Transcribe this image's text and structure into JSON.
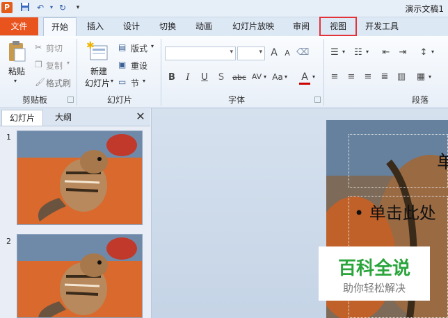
{
  "title_bar": {
    "app_logo": "P",
    "document_title": "演示文稿1"
  },
  "tabs": [
    {
      "label": "文件"
    },
    {
      "label": "开始"
    },
    {
      "label": "插入"
    },
    {
      "label": "设计"
    },
    {
      "label": "切换"
    },
    {
      "label": "动画"
    },
    {
      "label": "幻灯片放映"
    },
    {
      "label": "审阅"
    },
    {
      "label": "视图"
    },
    {
      "label": "开发工具"
    }
  ],
  "ribbon": {
    "clipboard": {
      "paste": "粘贴",
      "cut": "剪切",
      "copy": "复制",
      "format_painter": "格式刷",
      "group_label": "剪贴板"
    },
    "slides": {
      "new_slide_line1": "新建",
      "new_slide_line2": "幻灯片",
      "layout": "版式",
      "reset": "重设",
      "section": "节",
      "group_label": "幻灯片"
    },
    "font": {
      "bold": "B",
      "italic": "I",
      "underline": "U",
      "shadow": "S",
      "strikethrough": "abc",
      "spacing": "AV",
      "case": "Aa",
      "color": "A",
      "grow": "A",
      "shrink": "A",
      "group_label": "字体"
    },
    "paragraph": {
      "group_label": "段落"
    }
  },
  "left_panel": {
    "tab_slides": "幻灯片",
    "tab_outline": "大纲",
    "close": "✕",
    "thumbnails": [
      {
        "number": "1"
      },
      {
        "number": "2"
      }
    ]
  },
  "slide": {
    "title_partial": "单",
    "body_bullet": "• 单击此处"
  },
  "watermark": {
    "title": "百科全说",
    "subtitle": "助你轻松解决"
  },
  "colors": {
    "file_tab": "#e9531d",
    "highlight_border": "#e2333b",
    "watermark_green": "#2aa53b"
  }
}
